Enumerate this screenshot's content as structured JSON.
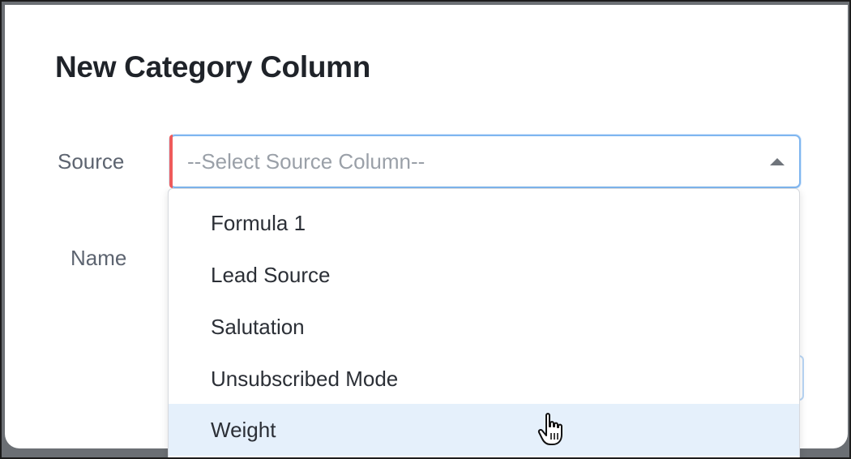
{
  "dialog": {
    "title": "New Category Column",
    "source_label": "Source",
    "name_label": "Name",
    "source_select": {
      "placeholder": "--Select Source Column--",
      "state": "open"
    },
    "source_options": [
      {
        "label": "Formula 1",
        "highlighted": false
      },
      {
        "label": "Lead Source",
        "highlighted": false
      },
      {
        "label": "Salutation",
        "highlighted": false
      },
      {
        "label": "Unsubscribed Mode",
        "highlighted": false
      },
      {
        "label": "Weight",
        "highlighted": true
      }
    ]
  },
  "icons": {
    "dropdown_caret": "caret-up-icon",
    "pointer": "hand-pointer-icon"
  },
  "colors": {
    "focus_border": "#7fb6f0",
    "required_marker": "#ef5b5b",
    "highlight_row": "#e5f0fb",
    "title_text": "#1f2329",
    "label_text": "#5d6470"
  }
}
